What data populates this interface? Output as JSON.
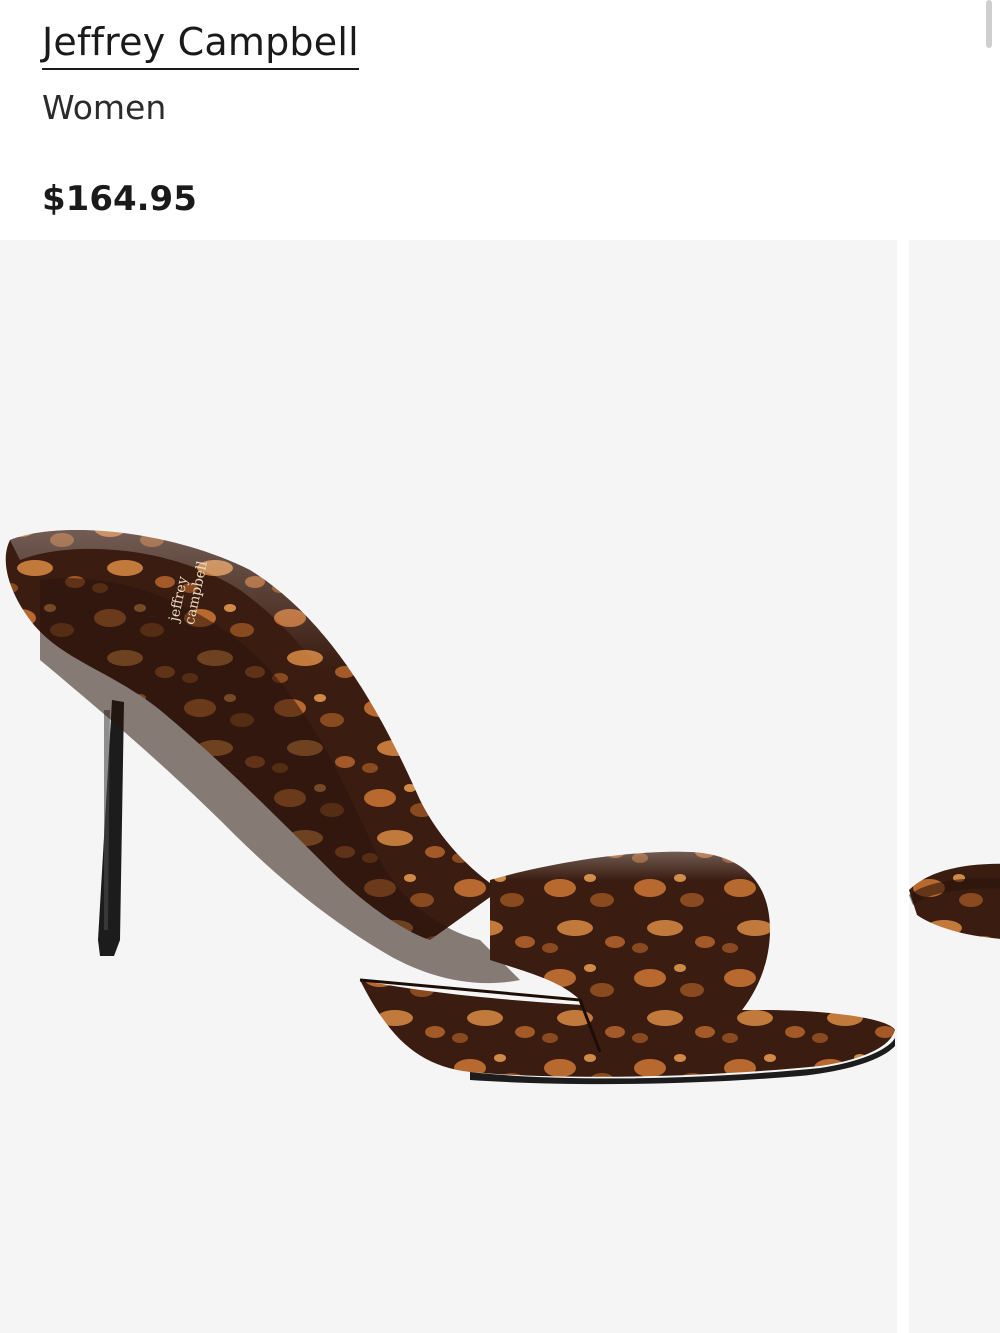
{
  "product": {
    "brand": "Jeffrey Campbell",
    "category": "Women",
    "price": "$164.95"
  },
  "gallery": {
    "images": [
      {
        "name": "product-image-tortoiseshell-mule",
        "logo_text": [
          "jeffrey",
          "campbell"
        ]
      },
      {
        "name": "product-image-next-preview"
      }
    ]
  },
  "colors": {
    "background": "#ffffff",
    "image_bg": "#f5f5f5",
    "tortoise_dark": "#3a1c10",
    "tortoise_light": "#b8692f",
    "heel": "#1c1c1c"
  }
}
